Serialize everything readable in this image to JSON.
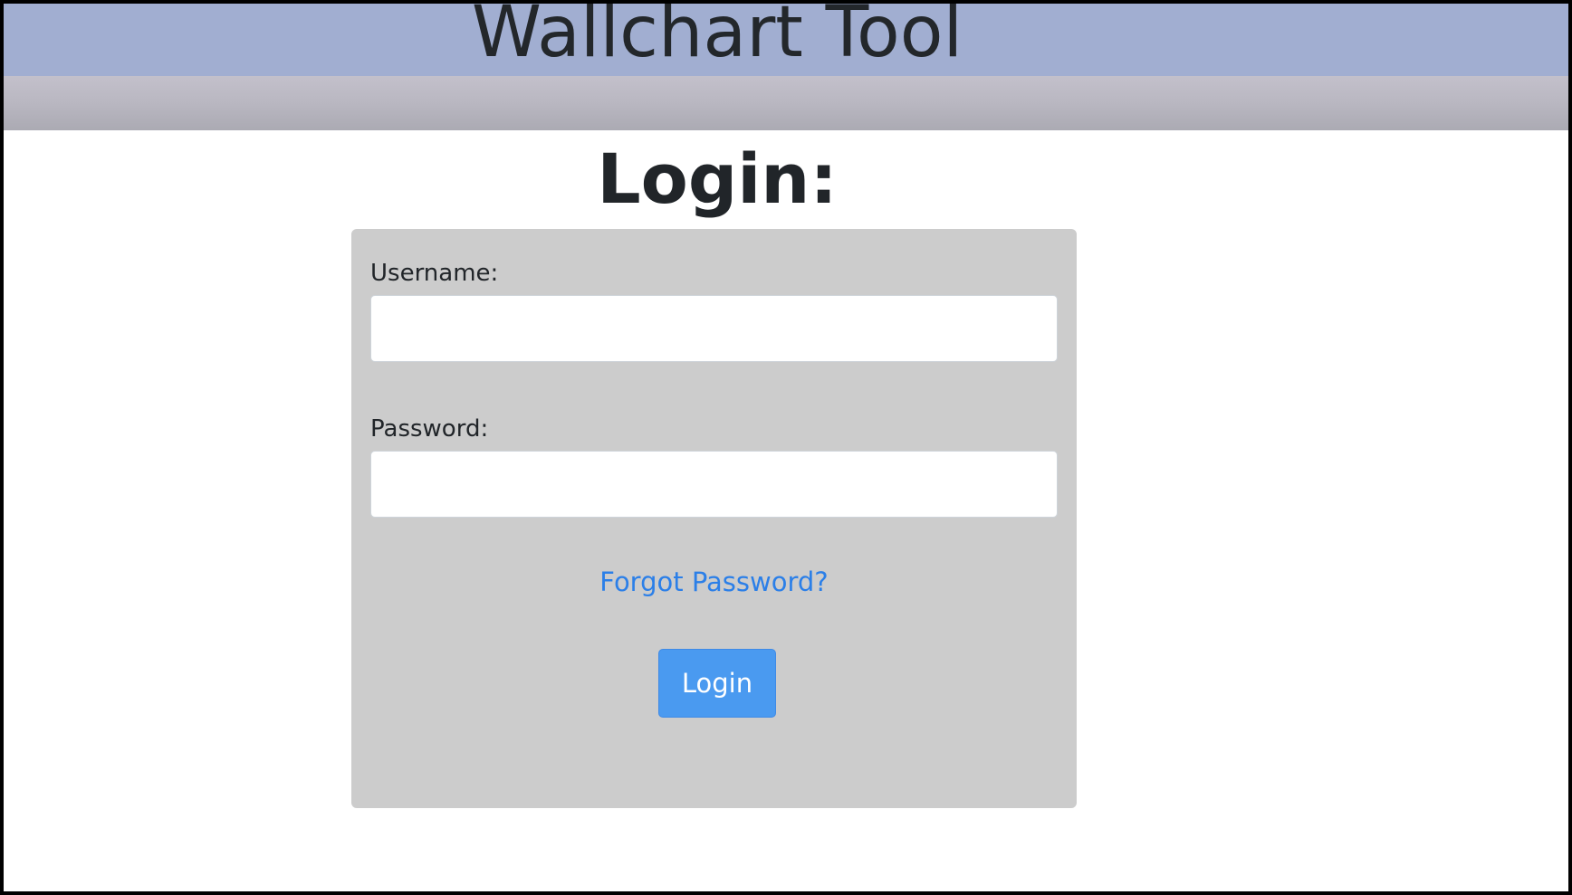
{
  "app": {
    "title": "Wallchart Tool"
  },
  "page": {
    "heading": "Login:"
  },
  "login_form": {
    "username_label": "Username:",
    "username_value": "",
    "password_label": "Password:",
    "password_value": "",
    "forgot_password_link": "Forgot Password?",
    "submit_label": "Login"
  },
  "colors": {
    "header_background": "#a1aed1",
    "nav_bar": "#b9b7c1",
    "panel_background": "#cccccc",
    "link": "#2b7fe8",
    "button_primary": "#4a9af0",
    "text_dark": "#212529"
  }
}
